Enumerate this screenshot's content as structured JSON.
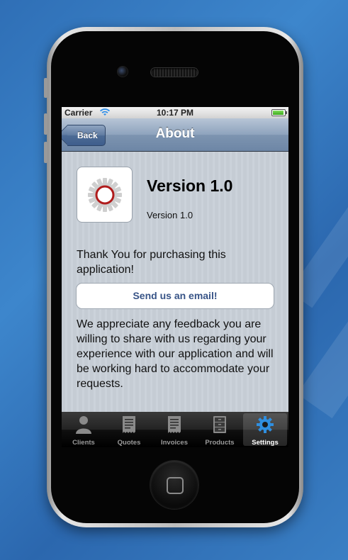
{
  "status_bar": {
    "carrier": "Carrier",
    "time": "10:17 PM"
  },
  "navbar": {
    "back_label": "Back",
    "title": "About"
  },
  "about": {
    "version_title": "Version 1.0",
    "version_subtitle": "Version 1.0",
    "thanks_text": "Thank You for purchasing this application!",
    "email_button": "Send us an email!",
    "feedback_text": "We appreciate any feedback you are willing to share with us regarding your experience with our application and will be working hard to accommodate your requests."
  },
  "tabs": [
    {
      "label": "Clients",
      "icon": "person-icon"
    },
    {
      "label": "Quotes",
      "icon": "receipt-icon"
    },
    {
      "label": "Invoices",
      "icon": "receipt-icon"
    },
    {
      "label": "Products",
      "icon": "cabinet-icon"
    },
    {
      "label": "Settings",
      "icon": "gear-icon"
    }
  ],
  "active_tab": "Settings",
  "colors": {
    "navbar": "#7d94b0",
    "accent_text": "#385487",
    "icon_ring": "#b01c1c",
    "settings_icon": "#2f8fe0"
  }
}
